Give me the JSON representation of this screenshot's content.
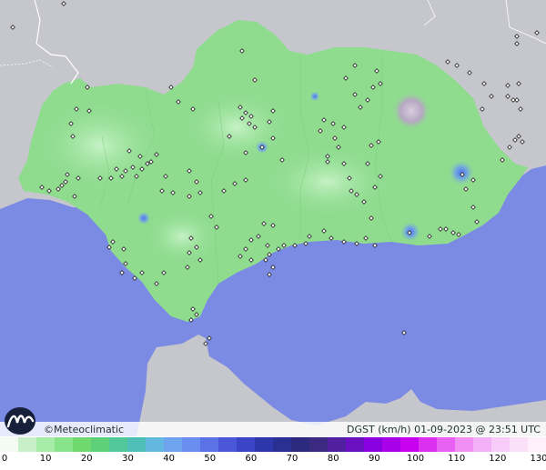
{
  "credit": "©Meteoclimatic",
  "legend": {
    "title": "DGST (km/h)  01-09-2023 @ 23:51 UTC"
  },
  "scale": {
    "ticks": [
      "0",
      "10",
      "20",
      "30",
      "40",
      "50",
      "60",
      "70",
      "80",
      "90",
      "100",
      "110",
      "120",
      "130"
    ],
    "colors": [
      "#f3fbf3",
      "#c8f0c8",
      "#a6eca6",
      "#88e488",
      "#6fd86f",
      "#5ed07a",
      "#52c89a",
      "#4fc0b8",
      "#63b8e0",
      "#6ea4ee",
      "#6a8ef0",
      "#5a72e6",
      "#4a58d8",
      "#3a44c4",
      "#2e36ac",
      "#283094",
      "#2b2a7e",
      "#3a2a80",
      "#5020a0",
      "#6a10c0",
      "#8a00e0",
      "#a800e8",
      "#c800f0",
      "#dc30f0",
      "#e860f4",
      "#f090f4",
      "#f4b0f6",
      "#f8ccf8",
      "#fce0fa",
      "#fff0fc"
    ]
  },
  "colors": {
    "sea": "#7b8ae2",
    "land_foreign": "#c6c6cd",
    "land_region": "#8fdc8f",
    "calm": "#a5e8a5",
    "gust_blue": "#5c7fea",
    "relief": "#b9a7c4"
  }
}
